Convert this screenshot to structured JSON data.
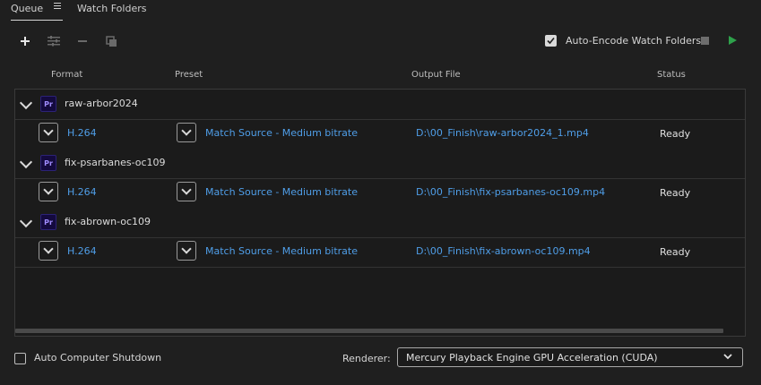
{
  "tabs": {
    "queue": "Queue",
    "watch_folders": "Watch Folders"
  },
  "toolbar": {
    "add_icon": "plus-icon",
    "settings_icon": "sliders-icon",
    "remove_icon": "minus-icon",
    "duplicate_icon": "duplicate-icon",
    "auto_encode_label": "Auto-Encode Watch Folders",
    "auto_encode_checked": true
  },
  "columns": {
    "format": "Format",
    "preset": "Preset",
    "output": "Output File",
    "status": "Status"
  },
  "queue": [
    {
      "name": "raw-arbor2024",
      "badge": "Pr",
      "format": "H.264",
      "preset": "Match Source - Medium bitrate",
      "output": "D:\\00_Finish\\raw-arbor2024_1.mp4",
      "status": "Ready"
    },
    {
      "name": "fix-psarbanes-oc109",
      "badge": "Pr",
      "format": "H.264",
      "preset": "Match Source - Medium bitrate",
      "output": "D:\\00_Finish\\fix-psarbanes-oc109.mp4",
      "status": "Ready"
    },
    {
      "name": "fix-abrown-oc109",
      "badge": "Pr",
      "format": "H.264",
      "preset": "Match Source - Medium bitrate",
      "output": "D:\\00_Finish\\fix-abrown-oc109.mp4",
      "status": "Ready"
    }
  ],
  "footer": {
    "shutdown_label": "Auto Computer Shutdown",
    "shutdown_checked": false,
    "renderer_label": "Renderer:",
    "renderer_value": "Mercury Playback Engine GPU Acceleration (CUDA)"
  },
  "colors": {
    "accent_link": "#4f9ee8",
    "play_green": "#2ea14b",
    "premiere_badge": "#140a3e"
  }
}
